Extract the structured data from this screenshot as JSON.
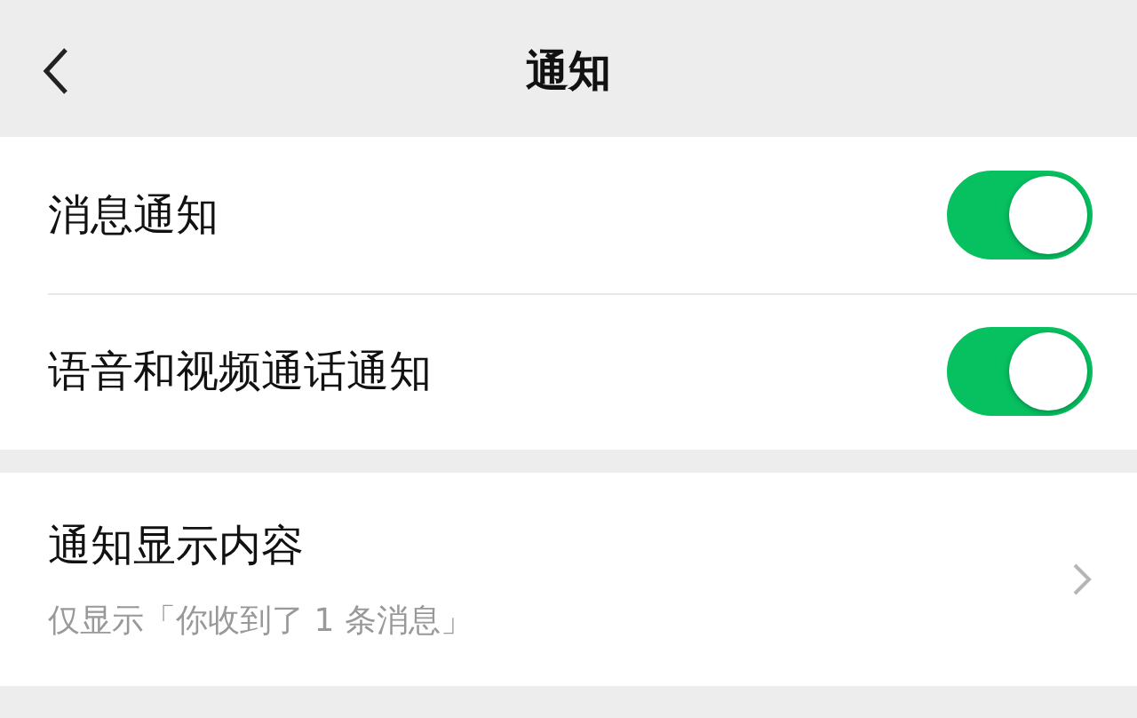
{
  "header": {
    "title": "通知"
  },
  "switches": [
    {
      "label": "消息通知",
      "on": true
    },
    {
      "label": "语音和视频通话通知",
      "on": true
    }
  ],
  "content_setting": {
    "label": "通知显示内容",
    "value": "仅显示「你收到了 1 条消息」"
  }
}
